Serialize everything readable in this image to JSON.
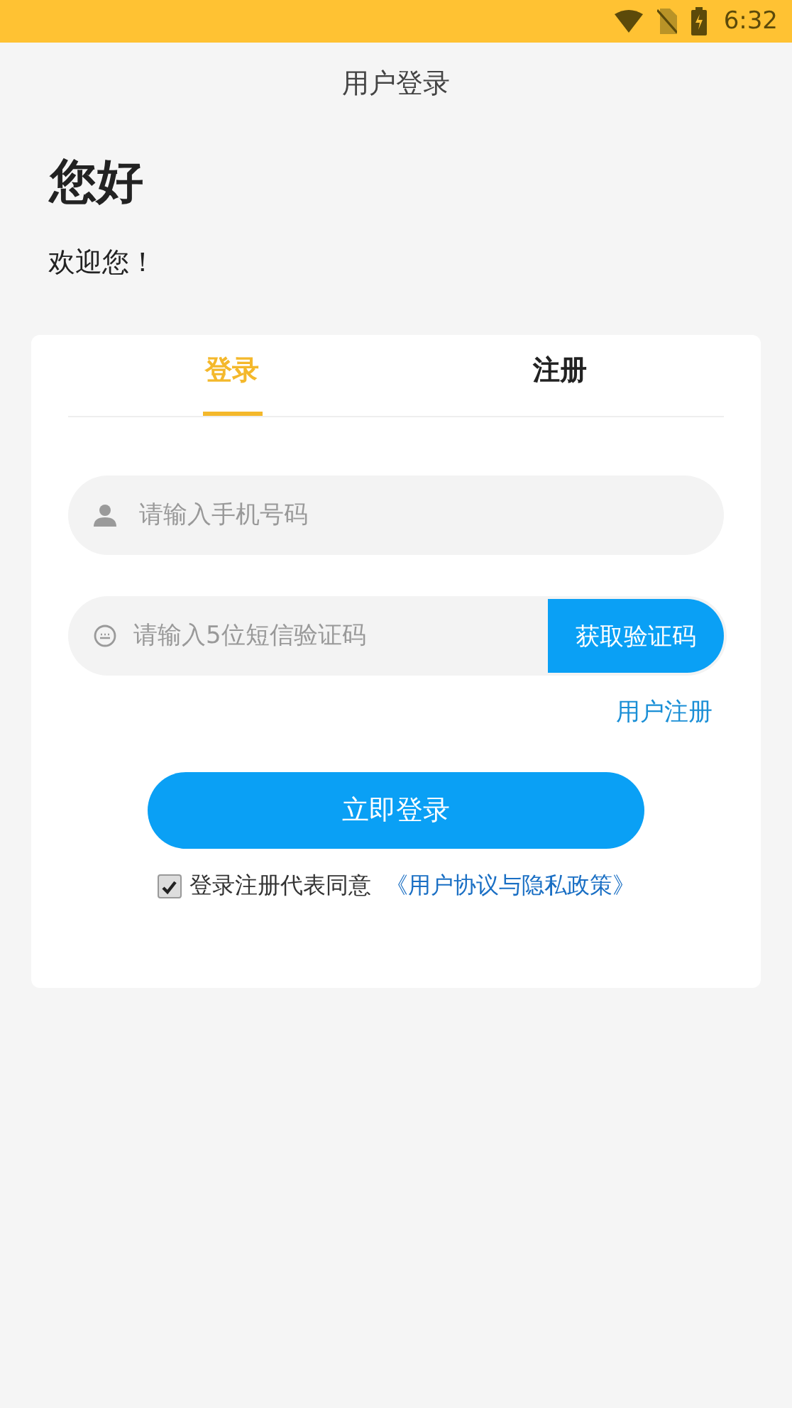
{
  "status_bar": {
    "time": "6:32"
  },
  "header": {
    "title": "用户登录"
  },
  "greeting": {
    "title": "您好",
    "subtitle": "欢迎您！"
  },
  "tabs": [
    {
      "label": "登录",
      "selected": true
    },
    {
      "label": "注册",
      "selected": false
    }
  ],
  "phone_field": {
    "placeholder": "请输入手机号码"
  },
  "code_field": {
    "placeholder": "请输入5位短信验证码",
    "button": "获取验证码"
  },
  "register_link": "用户注册",
  "login_button": "立即登录",
  "agreement": {
    "checked": true,
    "text": "登录注册代表同意",
    "link": "《用户协议与隐私政策》"
  }
}
